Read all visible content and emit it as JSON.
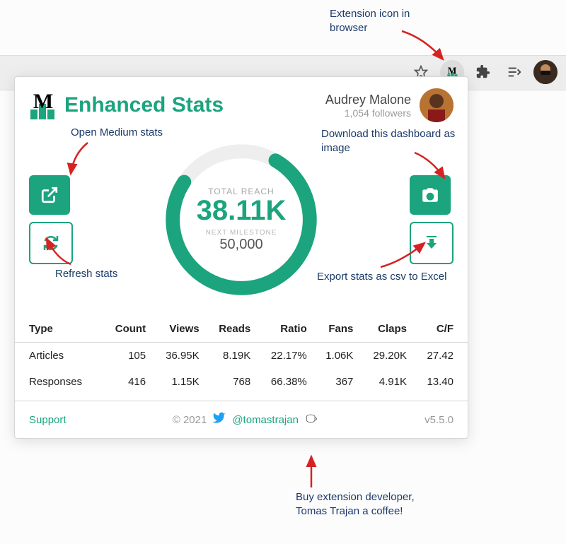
{
  "browser_annotation": "Extension icon in browser",
  "popup": {
    "title": "Enhanced Stats",
    "user": {
      "name": "Audrey Malone",
      "followers": "1,054 followers"
    },
    "gauge": {
      "reach_label": "TOTAL REACH",
      "reach_value": "38.11K",
      "next_label": "NEXT MILESTONE",
      "next_value": "50,000"
    },
    "table": {
      "headers": [
        "Type",
        "Count",
        "Views",
        "Reads",
        "Ratio",
        "Fans",
        "Claps",
        "C/F"
      ],
      "rows": [
        [
          "Articles",
          "105",
          "36.95K",
          "8.19K",
          "22.17%",
          "1.06K",
          "29.20K",
          "27.42"
        ],
        [
          "Responses",
          "416",
          "1.15K",
          "768",
          "66.38%",
          "367",
          "4.91K",
          "13.40"
        ]
      ]
    },
    "footer": {
      "support": "Support",
      "copyright": "© 2021",
      "handle": "@tomastrajan",
      "version": "v5.5.0"
    }
  },
  "annotations": {
    "open_stats": "Open Medium stats",
    "refresh": "Refresh stats",
    "download_image": "Download this dashboard as image",
    "export_csv": "Export stats as csv to Excel",
    "coffee": "Buy extension developer, Tomas Trajan a coffee!"
  }
}
